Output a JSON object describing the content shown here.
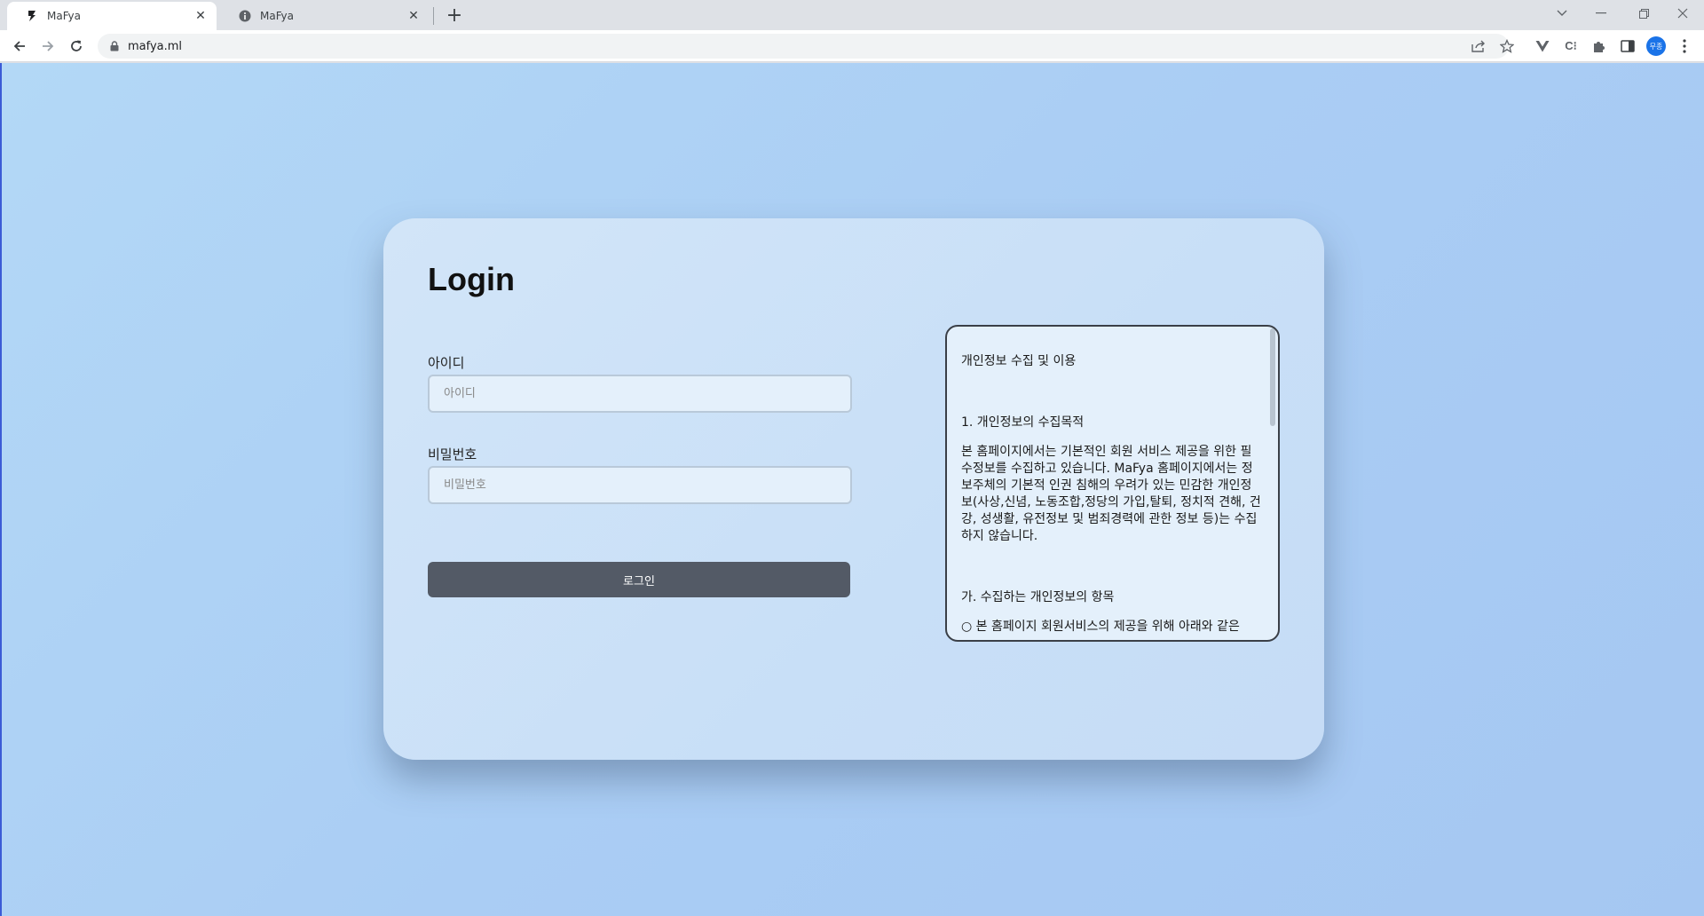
{
  "browser": {
    "tabs": [
      {
        "title": "MaFya",
        "active": true
      },
      {
        "title": "MaFya",
        "active": false
      }
    ],
    "url": "mafya.ml",
    "profile_initials": "무종"
  },
  "login": {
    "title": "Login",
    "id_label": "아이디",
    "id_placeholder": "아이디",
    "id_value": "",
    "password_label": "비밀번호",
    "password_placeholder": "비밀번호",
    "password_value": "",
    "submit_label": "로그인"
  },
  "terms": {
    "heading": "개인정보 수집 및 이용",
    "section1_title": "1. 개인정보의 수집목적",
    "section1_body": "본 홈페이지에서는 기본적인 회원 서비스 제공을 위한 필수정보를 수집하고 있습니다. MaFya 홈페이지에서는 정보주체의 기본적 인권 침해의 우려가 있는 민감한 개인정보(사상,신념, 노동조합,정당의 가입,탈퇴, 정치적 견해, 건강, 성생활, 유전정보 및 범죄경력에 관한 정보 등)는 수집하지 않습니다.",
    "section2_title": "가. 수집하는 개인정보의 항목",
    "section2_body": "○ 본 홈페이지 회원서비스의 제공을 위해 아래와 같은"
  },
  "colors": {
    "page_bg": "#aacdf4",
    "card_bg": "#cfe3f8",
    "button_bg": "#535a66"
  }
}
